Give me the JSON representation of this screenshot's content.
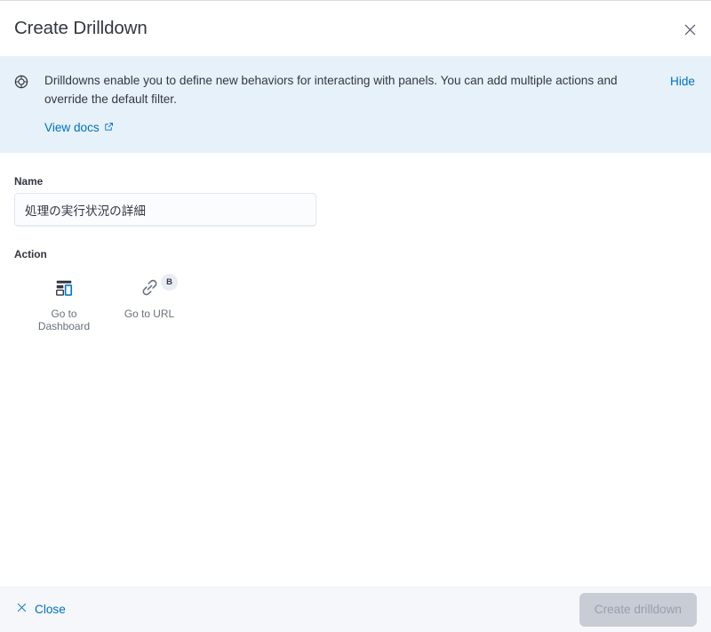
{
  "header": {
    "title": "Create Drilldown",
    "close_icon": "close-icon"
  },
  "callout": {
    "icon": "help-circle-icon",
    "text": "Drilldowns enable you to define new behaviors for interacting with panels. You can add multiple actions and override the default filter.",
    "link_label": "View docs",
    "link_icon": "external-link-icon",
    "hide_label": "Hide"
  },
  "form": {
    "name_label": "Name",
    "name_value": "処理の実行状況の詳細",
    "name_placeholder": "",
    "action_label": "Action"
  },
  "actions": [
    {
      "label": "Go to Dashboard",
      "icon": "dashboard-app-icon",
      "badge": ""
    },
    {
      "label": "Go to URL",
      "icon": "link-icon",
      "badge": "B"
    }
  ],
  "footer": {
    "close_label": "Close",
    "close_icon": "cross-icon",
    "create_label": "Create drilldown",
    "create_disabled": true
  },
  "colors": {
    "accent_link": "#0071c2",
    "callout_bg": "#e6f1fa",
    "footer_bg": "#f5f7fa",
    "text_primary": "#343741",
    "text_subdued": "#69707d",
    "disabled_btn_bg": "#c8ccd4",
    "disabled_btn_text": "#97a0af",
    "badge_bg": "#e9edf3"
  }
}
